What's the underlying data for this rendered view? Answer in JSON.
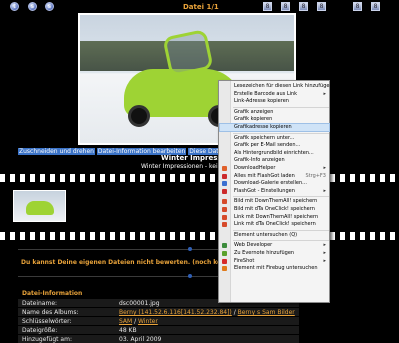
{
  "header": {
    "file_title": "Datei 1/1"
  },
  "nav_left": [
    "t",
    "s",
    "s"
  ],
  "nav_right": [
    "8",
    "8",
    "8",
    "8",
    "8",
    "8"
  ],
  "photo_caption": {
    "links": [
      "Zuschneiden und drehen",
      "Datei-Information bearbeiten",
      "Diese Datei löschen"
    ],
    "title": "Winter Impressionen",
    "subtitle": "Winter Impressionen - keine Degen"
  },
  "rating_message": "Du kannst Deine eigenen Dateien nicht bewerten. (noch keine Bewert",
  "file_info": {
    "heading": "Datei-Information",
    "rows": [
      {
        "key": "Dateiname:",
        "value": "dsc00001.jpg"
      },
      {
        "key": "Name des Albums:",
        "value_links": [
          "Berny (141.52.6.116[141.52.232.84])",
          "Berny s Sam Bilder"
        ]
      },
      {
        "key": "Schlüsselwörter:",
        "value_links": [
          "SAM",
          "Winter"
        ]
      },
      {
        "key": "Dateigröße:",
        "value": "48 KB"
      },
      {
        "key": "Hinzugefügt am:",
        "value": "03. April 2009"
      }
    ]
  },
  "context_menu": {
    "items": [
      {
        "label": "Lesezeichen für diesen Link hinzufügen",
        "icon": "none"
      },
      {
        "label": "Erstelle Barcode aus Link",
        "arrow": "▸",
        "icon": "none"
      },
      {
        "label": "Link-Adresse kopieren",
        "icon": "none"
      },
      {
        "sep": true
      },
      {
        "label": "Grafik anzeigen",
        "icon": "none"
      },
      {
        "label": "Grafik kopieren",
        "icon": "none"
      },
      {
        "label": "Grafikadresse kopieren",
        "icon": "none",
        "highlight": true
      },
      {
        "sep": true
      },
      {
        "label": "Grafik speichern unter...",
        "icon": "none"
      },
      {
        "label": "Grafik per E-Mail senden...",
        "icon": "none"
      },
      {
        "label": "Als Hintergrundbild einrichten...",
        "icon": "none"
      },
      {
        "label": "Grafik-Info anzeigen",
        "icon": "none"
      },
      {
        "label": "DownloadHelper",
        "arrow": "▸",
        "icon": "downloadhelper-icon",
        "color": "#e0602a"
      },
      {
        "label": "Alles mit FlashGot laden",
        "shortcut": "Strg+F3",
        "icon": "flashgot-icon",
        "color": "#cc2a2a"
      },
      {
        "label": "Download-Galerie erstellen...",
        "icon": "flashgot-icon",
        "color": "#3a6fd0"
      },
      {
        "label": "FlashGot - Einstellungen",
        "arrow": "▸",
        "icon": "flashgot-icon",
        "color": "#cc2a2a"
      },
      {
        "sep": true
      },
      {
        "label": "Bild mit DownThemAll! speichern",
        "icon": "downthemall-icon",
        "color": "#d64a2a"
      },
      {
        "label": "Bild mit dTa OneClick! speichern",
        "icon": "downthemall-icon",
        "color": "#d64a2a"
      },
      {
        "label": "Link mit DownThemAll! speichern",
        "icon": "downthemall-icon",
        "color": "#d64a2a"
      },
      {
        "label": "Link mit dTa OneClick! speichern",
        "icon": "downthemall-icon",
        "color": "#d64a2a"
      },
      {
        "sep": true
      },
      {
        "label": "Element untersuchen (Q)",
        "icon": "none"
      },
      {
        "sep": true
      },
      {
        "label": "Web Developer",
        "arrow": "▸",
        "icon": "web-developer-icon",
        "color": "#3c8c3c"
      },
      {
        "label": "Zu Evernote hinzufügen",
        "arrow": "▸",
        "icon": "evernote-icon",
        "color": "#5aa02c"
      },
      {
        "label": "FireShot",
        "arrow": "▸",
        "icon": "fireshot-icon",
        "color": "#d62a2a"
      },
      {
        "label": "Element mit Firebug untersuchen",
        "icon": "firebug-icon",
        "color": "#e07a1a"
      }
    ]
  }
}
